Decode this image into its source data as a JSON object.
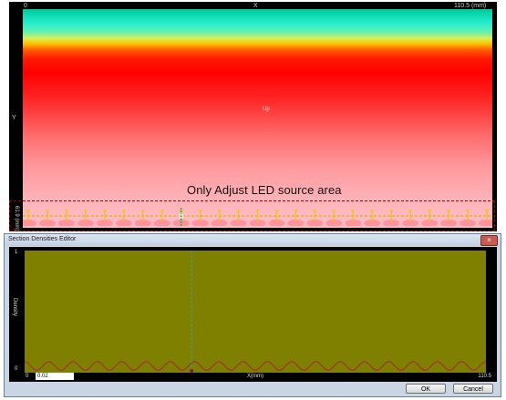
{
  "top_view": {
    "ruler_x_start": "0",
    "ruler_x_label": "X",
    "ruler_x_end": "110.5 (mm)",
    "ruler_y_label": "Y",
    "ruler_y_bottom": "61.9 (mm)",
    "center_label": "Up",
    "caption": "Only Adjust  LED source area",
    "led_count": 25
  },
  "dialog": {
    "title": "Section Densities Editor",
    "close_label": "×",
    "x_min": "0",
    "x_value": "0.02",
    "x_label": "X(mm)",
    "x_max": "110.5",
    "y_top": "1",
    "y_bottom": "0",
    "y_label": "Density",
    "ok_label": "OK",
    "cancel_label": "Cancel"
  },
  "chart_data": {
    "type": "line",
    "xlabel": "X(mm)",
    "ylabel": "Density",
    "xlim": [
      0,
      110.5
    ],
    "ylim": [
      0,
      1
    ],
    "series": [
      {
        "wave_count": 19,
        "amplitude": 0.07,
        "baseline": 0.02
      }
    ],
    "cursor_x": 40,
    "colors": {
      "background": "#808000",
      "line": "#9a3a3a",
      "cursor": "#2aa7a7"
    }
  }
}
